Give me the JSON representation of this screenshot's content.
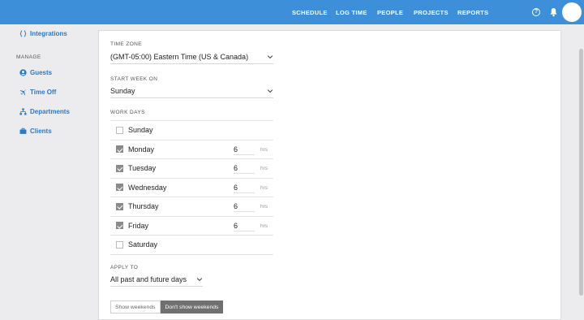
{
  "topnav": {
    "items": [
      {
        "label": "SCHEDULE"
      },
      {
        "label": "LOG TIME"
      },
      {
        "label": "PEOPLE"
      },
      {
        "label": "PROJECTS"
      },
      {
        "label": "REPORTS"
      }
    ],
    "help_glyph": "?"
  },
  "sidebar": {
    "integrations_label": "Integrations",
    "manage_heading": "MANAGE",
    "items": [
      {
        "label": "Guests",
        "icon": "person-icon"
      },
      {
        "label": "Time Off",
        "icon": "airplane-icon"
      },
      {
        "label": "Departments",
        "icon": "org-chart-icon"
      },
      {
        "label": "Clients",
        "icon": "briefcase-icon"
      }
    ]
  },
  "settings": {
    "timezone": {
      "label": "TIME ZONE",
      "value": "(GMT-05:00) Eastern Time (US & Canada)"
    },
    "start_week": {
      "label": "START WEEK ON",
      "value": "Sunday"
    },
    "work_days": {
      "label": "WORK DAYS",
      "unit": "hrs",
      "days": [
        {
          "name": "Sunday",
          "checked": false,
          "hours": ""
        },
        {
          "name": "Monday",
          "checked": true,
          "hours": "6"
        },
        {
          "name": "Tuesday",
          "checked": true,
          "hours": "6"
        },
        {
          "name": "Wednesday",
          "checked": true,
          "hours": "6"
        },
        {
          "name": "Thursday",
          "checked": true,
          "hours": "6"
        },
        {
          "name": "Friday",
          "checked": true,
          "hours": "6"
        },
        {
          "name": "Saturday",
          "checked": false,
          "hours": ""
        }
      ]
    },
    "apply_to": {
      "label": "APPLY TO",
      "value": "All past and future days"
    },
    "weekends": {
      "show_label": "Show weekends",
      "hide_label": "Don't show weekends",
      "selected": "hide"
    }
  },
  "colors": {
    "accent": "#3d8fd9",
    "link": "#2b78c4",
    "checked": "#8a8a8a"
  }
}
